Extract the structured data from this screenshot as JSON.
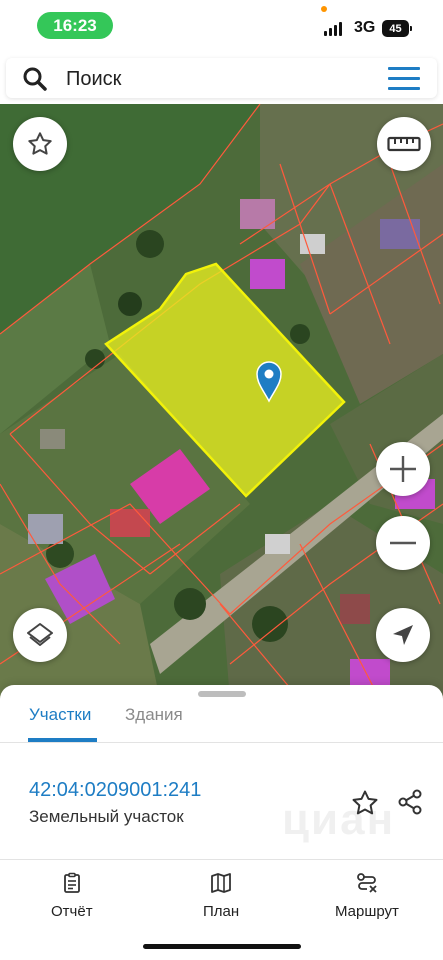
{
  "status_bar": {
    "time": "16:23",
    "network": "3G",
    "battery": "45"
  },
  "search": {
    "placeholder": "Поиск",
    "icon": "search-icon",
    "menu_icon": "hamburger-menu-icon"
  },
  "map": {
    "highlight_color": "#e8f020",
    "boundary_color": "#ff5a3c",
    "marker_color": "#1e7dc4",
    "controls": {
      "favorite": "star-icon",
      "measure": "ruler-icon",
      "zoom_in": "plus-icon",
      "zoom_out": "minus-icon",
      "layers": "layers-icon",
      "locate": "navigation-arrow-icon"
    }
  },
  "sheet": {
    "tabs": [
      {
        "label": "Участки",
        "active": true
      },
      {
        "label": "Здания",
        "active": false
      }
    ],
    "parcel": {
      "cadastral_number": "42:04:0209001:241",
      "type": "Земельный участок"
    },
    "watermark": "циан",
    "nav": [
      {
        "label": "Отчёт",
        "icon": "report-icon"
      },
      {
        "label": "План",
        "icon": "map-plan-icon"
      },
      {
        "label": "Маршрут",
        "icon": "route-icon"
      }
    ]
  },
  "colors": {
    "accent": "#1e7dc4",
    "time_pill": "#34c759"
  }
}
